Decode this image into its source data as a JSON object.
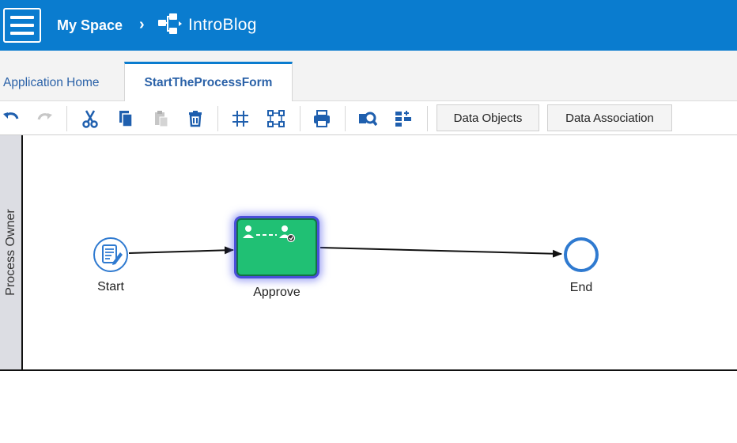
{
  "header": {
    "menu_icon": "hamburger-icon",
    "breadcrumb": {
      "space": "My Space",
      "separator": "›",
      "app_icon": "process-app-icon",
      "app": "IntroBlog"
    },
    "background_color": "#0a7ccf"
  },
  "tabs": [
    {
      "label": "Application Home",
      "active": false
    },
    {
      "label": "StartTheProcessForm",
      "active": true
    }
  ],
  "toolbar": {
    "icons": [
      "undo-icon",
      "redo-icon",
      "cut-icon",
      "copy-icon",
      "paste-icon",
      "delete-icon",
      "grid-icon",
      "fit-selection-icon",
      "print-icon",
      "zoom-find-icon",
      "align-icon"
    ],
    "buttons": {
      "data_objects": "Data Objects",
      "data_association": "Data Association"
    }
  },
  "diagram": {
    "lane": {
      "label": "Process Owner"
    },
    "nodes": {
      "start": {
        "label": "Start",
        "icon": "form-start-icon"
      },
      "task": {
        "label": "Approve",
        "icon": "approval-task-icon",
        "selected": true,
        "color": "#20c074"
      },
      "end": {
        "label": "End"
      }
    }
  }
}
